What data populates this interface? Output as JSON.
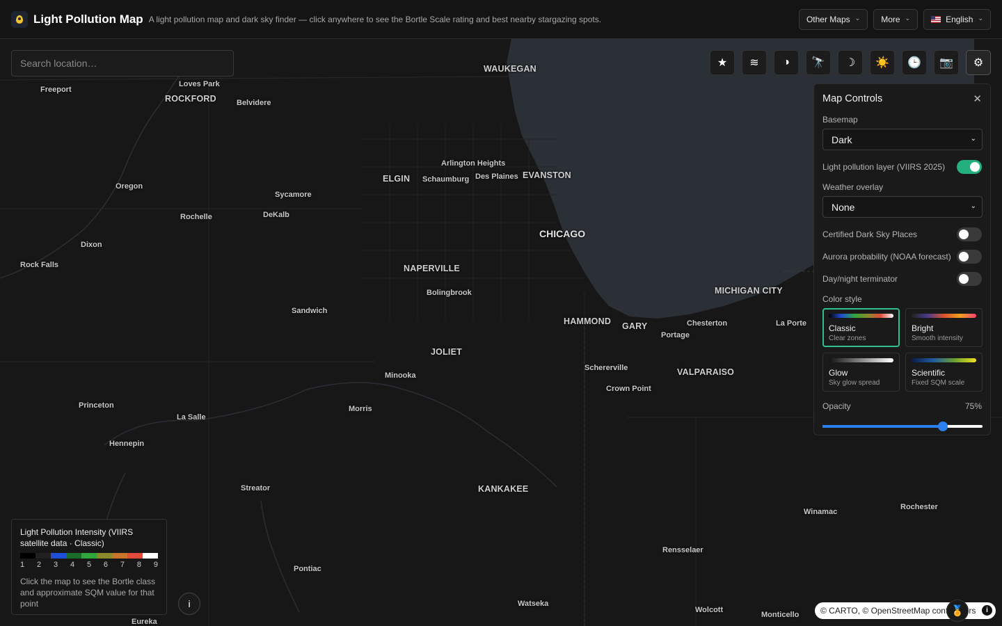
{
  "header": {
    "title": "Light Pollution Map",
    "subtitle": "A light pollution map and dark sky finder — click anywhere to see the Bortle Scale rating and best nearby stargazing spots.",
    "buttons": {
      "other_maps": "Other Maps",
      "more": "More",
      "language": "English"
    }
  },
  "search": {
    "placeholder": "Search location…"
  },
  "toolbar": {
    "icons": [
      "star-icon",
      "waves-icon",
      "contrast-icon",
      "telescope-icon",
      "moon-icon",
      "sun-icon",
      "clock-icon",
      "camera-icon",
      "gear-icon"
    ],
    "glyphs": {
      "star": "★",
      "waves": "≋",
      "contrast": "◑",
      "telescope": "🔭",
      "moon": "☽",
      "sun": "☀️",
      "clock": "🕒",
      "camera": "📷",
      "gear": "⚙"
    }
  },
  "panel": {
    "title": "Map Controls",
    "basemap": {
      "label": "Basemap",
      "value": "Dark"
    },
    "light_layer": {
      "label": "Light pollution layer (VIIRS 2025)",
      "on": true
    },
    "weather": {
      "label": "Weather overlay",
      "value": "None"
    },
    "dark_sky": {
      "label": "Certified Dark Sky Places",
      "on": false
    },
    "aurora": {
      "label": "Aurora probability (NOAA forecast)",
      "on": false
    },
    "terminator": {
      "label": "Day/night terminator",
      "on": false
    },
    "color_style": {
      "label": "Color style",
      "options": [
        {
          "name": "Classic",
          "desc": "Clear zones",
          "selected": true
        },
        {
          "name": "Bright",
          "desc": "Smooth intensity",
          "selected": false
        },
        {
          "name": "Glow",
          "desc": "Sky glow spread",
          "selected": false
        },
        {
          "name": "Scientific",
          "desc": "Fixed SQM scale",
          "selected": false
        }
      ]
    },
    "opacity": {
      "label": "Opacity",
      "value_text": "75%",
      "value": 0.75
    }
  },
  "legend": {
    "title": "Light Pollution Intensity (VIIRS satellite data · Classic)",
    "scale": [
      "1",
      "2",
      "3",
      "4",
      "5",
      "6",
      "7",
      "8",
      "9"
    ],
    "colors": [
      "#000000",
      "#202020",
      "#1f4fd6",
      "#1b6b2a",
      "#2fa63a",
      "#8a8a2a",
      "#c9742a",
      "#e24a3a",
      "#ffffff"
    ],
    "help": "Click the map to see the Bortle class and approximate SQM value for that point"
  },
  "info_button": "i",
  "attribution": {
    "text": "© CARTO, © OpenStreetMap contributors",
    "info": "i"
  },
  "map_labels": [
    {
      "text": "WAUKEGAN"
    },
    {
      "text": "Freeport"
    },
    {
      "text": "Loves Park"
    },
    {
      "text": "ROCKFORD"
    },
    {
      "text": "Belvidere"
    },
    {
      "text": "Arlington Heights"
    },
    {
      "text": "ELGIN"
    },
    {
      "text": "Schaumburg"
    },
    {
      "text": "Des Plaines"
    },
    {
      "text": "EVANSTON"
    },
    {
      "text": "Oregon"
    },
    {
      "text": "Sycamore"
    },
    {
      "text": "Rochelle"
    },
    {
      "text": "DeKalb"
    },
    {
      "text": "CHICAGO"
    },
    {
      "text": "Dixon"
    },
    {
      "text": "Rock Falls"
    },
    {
      "text": "NAPERVILLE"
    },
    {
      "text": "Bolingbrook"
    },
    {
      "text": "MICHIGAN CITY"
    },
    {
      "text": "Sandwich"
    },
    {
      "text": "HAMMOND"
    },
    {
      "text": "GARY"
    },
    {
      "text": "Chesterton"
    },
    {
      "text": "La Porte"
    },
    {
      "text": "Portage"
    },
    {
      "text": "JOLIET"
    },
    {
      "text": "Schererville"
    },
    {
      "text": "VALPARAISO"
    },
    {
      "text": "Minooka"
    },
    {
      "text": "Crown Point"
    },
    {
      "text": "Princeton"
    },
    {
      "text": "Morris"
    },
    {
      "text": "La Salle"
    },
    {
      "text": "Hennepin"
    },
    {
      "text": "Streator"
    },
    {
      "text": "KANKAKEE"
    },
    {
      "text": "Winamac"
    },
    {
      "text": "Rochester"
    },
    {
      "text": "Rensselaer"
    },
    {
      "text": "Pontiac"
    },
    {
      "text": "Watseka"
    },
    {
      "text": "Wolcott"
    },
    {
      "text": "Monticello"
    },
    {
      "text": "Eureka"
    }
  ]
}
